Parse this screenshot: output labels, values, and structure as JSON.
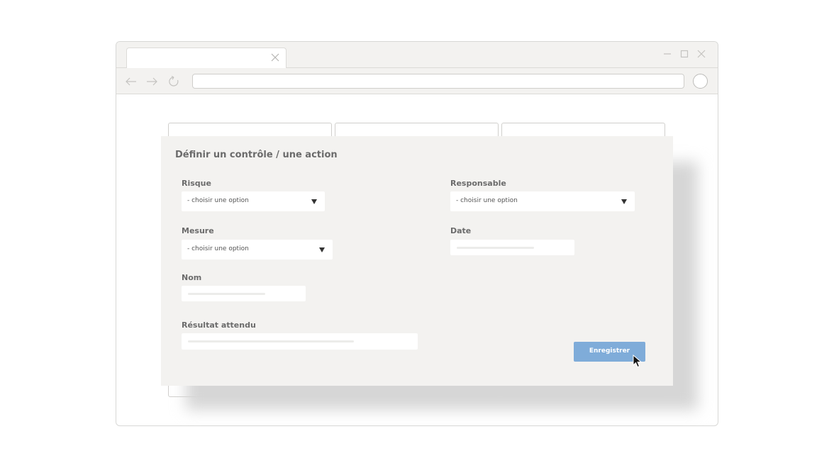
{
  "browser": {
    "tab_title": "",
    "address_value": "",
    "icons": {
      "tab_close": "close-icon",
      "minimize": "minimize-icon",
      "maximize": "maximize-icon",
      "close": "close-icon",
      "back": "arrow-left-icon",
      "forward": "arrow-right-icon",
      "reload": "reload-icon",
      "profile": "profile-icon"
    }
  },
  "modal": {
    "title": "Définir un contrôle / une action",
    "fields": {
      "risque": {
        "label": "Risque",
        "value": "- choisir une option"
      },
      "responsable": {
        "label": "Responsable",
        "value": "- choisir une option"
      },
      "mesure": {
        "label": "Mesure",
        "value": "- choisir une option"
      },
      "date": {
        "label": "Date",
        "value": ""
      },
      "nom": {
        "label": "Nom",
        "value": ""
      },
      "resultat": {
        "label": "Résultat attendu",
        "value": ""
      }
    },
    "save_label": "Enregistrer"
  },
  "colors": {
    "accent": "#7facd9",
    "modal_bg": "#f3f2f0",
    "label_text": "#6b6b6b"
  }
}
